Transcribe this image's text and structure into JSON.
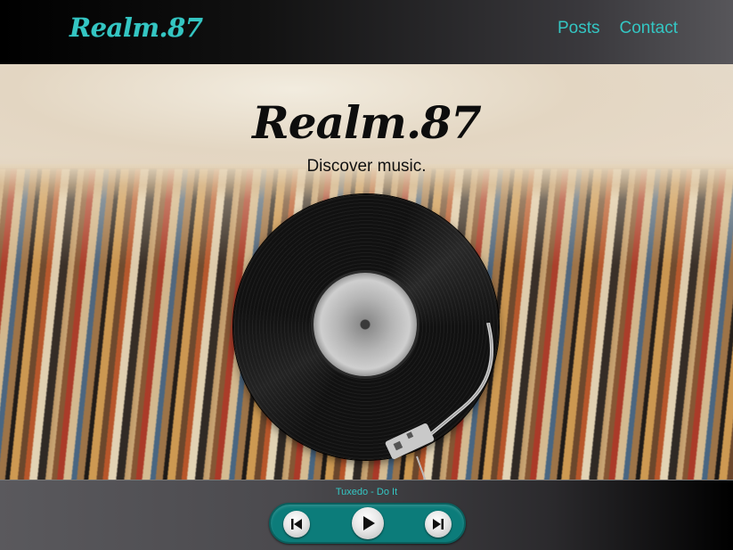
{
  "header": {
    "logo": "Realm.87",
    "nav": [
      {
        "label": "Posts"
      },
      {
        "label": "Contact"
      }
    ]
  },
  "hero": {
    "title": "Realm.87",
    "subtitle": "Discover music."
  },
  "player": {
    "track": "Tuxedo - Do It",
    "controls": [
      {
        "icon": "skip-previous-icon"
      },
      {
        "icon": "play-icon"
      },
      {
        "icon": "skip-next-icon"
      }
    ]
  },
  "colors": {
    "accent": "#34c6c3",
    "player_bg": "#0c7c7a"
  }
}
